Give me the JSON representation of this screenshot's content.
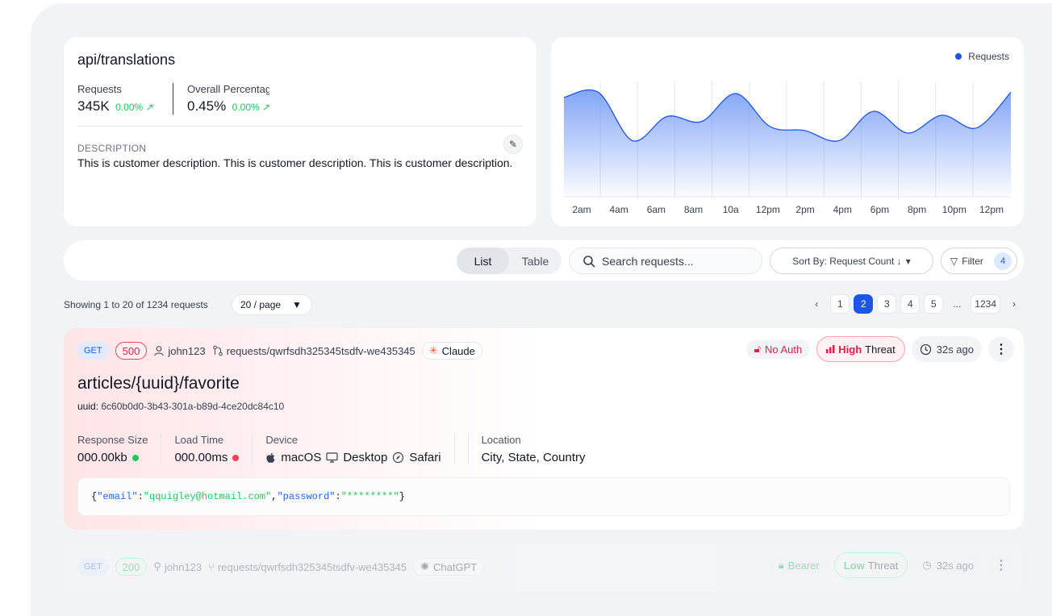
{
  "summary": {
    "endpoint": "api/translations",
    "metrics": [
      {
        "label": "Requests",
        "value": "345K",
        "change": "0.00% ↗"
      },
      {
        "label": "Overall Percentage",
        "value": "0.45%",
        "change": "0.00% ↗"
      }
    ],
    "description_label": "DESCRIPTION",
    "description": "This is customer description. This is customer description. This is customer description."
  },
  "chart_data": {
    "type": "area",
    "legend": [
      "Requests"
    ],
    "legend_position": "top-right",
    "grid": "vertical",
    "x_ticks": [
      "2am",
      "4am",
      "6am",
      "8am",
      "10a",
      "12pm",
      "2pm",
      "4pm",
      "6pm",
      "8pm",
      "10pm",
      "12pm"
    ],
    "series": [
      {
        "name": "Requests",
        "color": "#1e55e6",
        "values": [
          0.78,
          0.82,
          0.44,
          0.63,
          0.59,
          0.81,
          0.55,
          0.52,
          0.44,
          0.67,
          0.5,
          0.64,
          0.54,
          0.82
        ]
      }
    ]
  },
  "toolbar": {
    "view_list": "List",
    "view_table": "Table",
    "search_placeholder": "Search requests...",
    "sort_label": "Sort By: Request Count ↓",
    "filter_label": "Filter",
    "filter_count": "4"
  },
  "pagination": {
    "showing": "Showing 1 to 20 of 1234 requests",
    "per_page": "20 / page",
    "pages": [
      "1",
      "2",
      "3",
      "4",
      "5"
    ],
    "ellipsis": "...",
    "last_page": "1234",
    "active_page": "2"
  },
  "requests": [
    {
      "method": "GET",
      "status": "500",
      "user": "john123",
      "path": "requests/qwrfsdh325345tsdfv-we435345",
      "model": "Claude",
      "auth": "No Auth",
      "threat_level": "High",
      "threat_word": "Threat",
      "time": "32s ago",
      "route": "articles/{uuid}/favorite",
      "uuid_label": "uuid:",
      "uuid": "6c60b0d0-3b43-301a-b89d-4ce20dc84c10",
      "stats": {
        "size_label": "Response Size",
        "size": "000.00kb",
        "load_label": "Load Time",
        "load": "000.00ms",
        "device_label": "Device",
        "os": "macOS",
        "type": "Desktop",
        "browser": "Safari",
        "location_label": "Location",
        "location": "City, State, Country"
      },
      "payload": {
        "k1": "\"email\"",
        "v1": "\"qquigley@hotmail.com\"",
        "k2": "\"password\"",
        "v2": "\"********\""
      }
    },
    {
      "method": "GET",
      "status": "200",
      "user": "john123",
      "path": "requests/qwrfsdh325345tsdfv-we435345",
      "model": "ChatGPT",
      "auth": "Bearer",
      "threat_level": "Low",
      "threat_word": "Threat",
      "time": "32s ago"
    }
  ],
  "colors": {
    "accent": "#1e55e6",
    "success": "#22c55e",
    "danger": "#e11d48"
  }
}
